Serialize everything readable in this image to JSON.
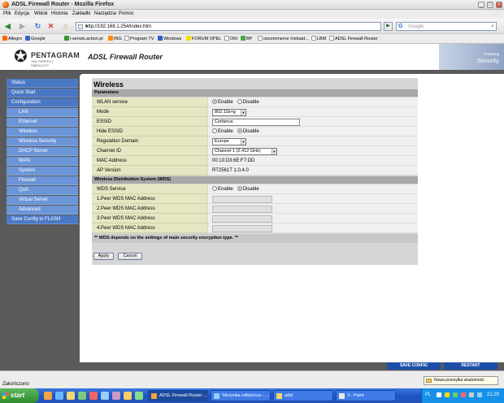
{
  "window": {
    "title": "ADSL Firewall Router - Mozilla Firefox"
  },
  "menu": [
    "Plik",
    "Edycja",
    "Widok",
    "Historia",
    "Zakładki",
    "Narzędzia",
    "Pomoc"
  ],
  "nav": {
    "url": "http://192.168.1.254/index.htm",
    "search_placeholder": "Google"
  },
  "bookmarks": [
    "Allegro",
    "Google",
    "i-serwis.action.pl",
    "ING",
    "Program TV",
    "Windows",
    "FORUM OPEL",
    "OKI",
    "BP",
    "oscommerce ćreload...",
    "LBM",
    "ADSL Firewall Router"
  ],
  "header": {
    "brand": "PENTAGRAM",
    "slogan": "THE PERFECT SIMPLICITY",
    "product_title": "ADSL Firewall Router",
    "tag1": "Powering",
    "tag2": "Security"
  },
  "sidebar": [
    {
      "label": "Status",
      "type": "main"
    },
    {
      "label": "Quick Start",
      "type": "main"
    },
    {
      "label": "Configuration",
      "type": "main"
    },
    {
      "label": "LAN",
      "type": "sub"
    },
    {
      "label": "Ethernet",
      "type": "sub"
    },
    {
      "label": "Wireless",
      "type": "sub"
    },
    {
      "label": "Wireless Security",
      "type": "sub"
    },
    {
      "label": "DHCP Server",
      "type": "sub"
    },
    {
      "label": "WAN",
      "type": "sub"
    },
    {
      "label": "System",
      "type": "sub"
    },
    {
      "label": "Firewall",
      "type": "sub"
    },
    {
      "label": "QoS",
      "type": "sub"
    },
    {
      "label": "Virtual Server",
      "type": "sub"
    },
    {
      "label": "Advanced",
      "type": "sub"
    },
    {
      "label": "Save Config to FLASH",
      "type": "main"
    }
  ],
  "wireless": {
    "title": "Wireless",
    "params_header": "Parameters",
    "wlan_service": {
      "label": "WLAN service",
      "enable": "Enable",
      "disable": "Disable"
    },
    "mode": {
      "label": "Mode",
      "value": "802.11b+g"
    },
    "essid": {
      "label": "ESSID",
      "value": "Cerberus"
    },
    "hide_essid": {
      "label": "Hide ESSID",
      "enable": "Enable",
      "disable": "Disable"
    },
    "reg_domain": {
      "label": "Regulation Domain",
      "value": "Europe"
    },
    "channel": {
      "label": "Channel ID",
      "value": "Channel 1 (2.412 GHz)"
    },
    "mac": {
      "label": "MAC Address",
      "value": "00:13:D3:6E:F7:DD"
    },
    "ap_version": {
      "label": "AP Version",
      "value": "RT2561T 1.0.4.0"
    },
    "wds_header": "Wireless Distribution System (WDS)",
    "wds_service": {
      "label": "WDS Service",
      "enable": "Enable",
      "disable": "Disable"
    },
    "peers": [
      "1.Peer WDS MAC Address",
      "2.Peer WDS MAC Address",
      "3.Peer WDS MAC Address",
      "4.Peer WDS MAC Address"
    ],
    "note": "** WDS depends on the settings of main security encryption type. **",
    "apply": "Apply",
    "cancel": "Cancel"
  },
  "footer_buttons": {
    "save": "SAVE CONFIG",
    "restart": "RESTART"
  },
  "status": {
    "text": "Zakończono",
    "notification": "Nowa przesyłka wiadomość"
  },
  "taskbar": {
    "start": "start",
    "tasks": [
      "ADSL Firewall Router ...",
      "Skrzynka odbiorcza - ...",
      "adsl",
      "3 - Paint"
    ],
    "lang": "PL",
    "clock": "21:29"
  }
}
